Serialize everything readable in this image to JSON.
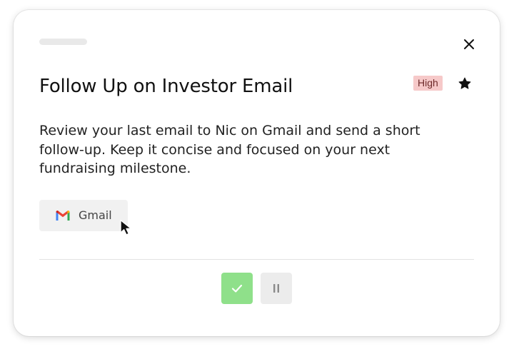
{
  "task": {
    "title": "Follow Up on Investor Email",
    "priority": "High",
    "starred": true,
    "description": "Review your last email to Nic on Gmail and send a short follow-up. Keep it concise and focused on your next fundraising milestone."
  },
  "app_chip": {
    "icon": "gmail-icon",
    "label": "Gmail"
  },
  "actions": {
    "complete_icon": "check-icon",
    "pause_icon": "pause-icon"
  },
  "colors": {
    "badge_bg": "#f6c9c9",
    "complete_bg": "#8fe08a",
    "pause_bg": "#ececec",
    "chip_bg": "#f1f1f1"
  }
}
